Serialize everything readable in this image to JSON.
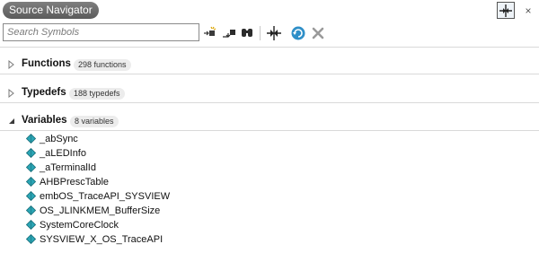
{
  "window": {
    "title": "Source Navigator",
    "close_glyph": "×"
  },
  "toolbar": {
    "search_placeholder": "Search Symbols",
    "search_value": "",
    "icons": [
      "filter-icon",
      "collapse-icon",
      "find-icon",
      "sync-icon",
      "refresh-icon",
      "clear-icon"
    ]
  },
  "sections": [
    {
      "title": "Functions",
      "count": "298 functions",
      "expanded": false
    },
    {
      "title": "Typedefs",
      "count": "188 typedefs",
      "expanded": false
    },
    {
      "title": "Variables",
      "count": "8 variables",
      "expanded": true
    }
  ],
  "variables": [
    "_abSync",
    "_aLEDInfo",
    "_aTerminalId",
    "AHBPrescTable",
    "embOS_TraceAPI_SYSVIEW",
    "OS_JLINKMEM_BufferSize",
    "SystemCoreClock",
    "SYSVIEW_X_OS_TraceAPI"
  ],
  "colors": {
    "title_pill": "#6b6b6b",
    "refresh_icon": "#2f8fc8",
    "variable_icon": "#2aa5b5"
  }
}
